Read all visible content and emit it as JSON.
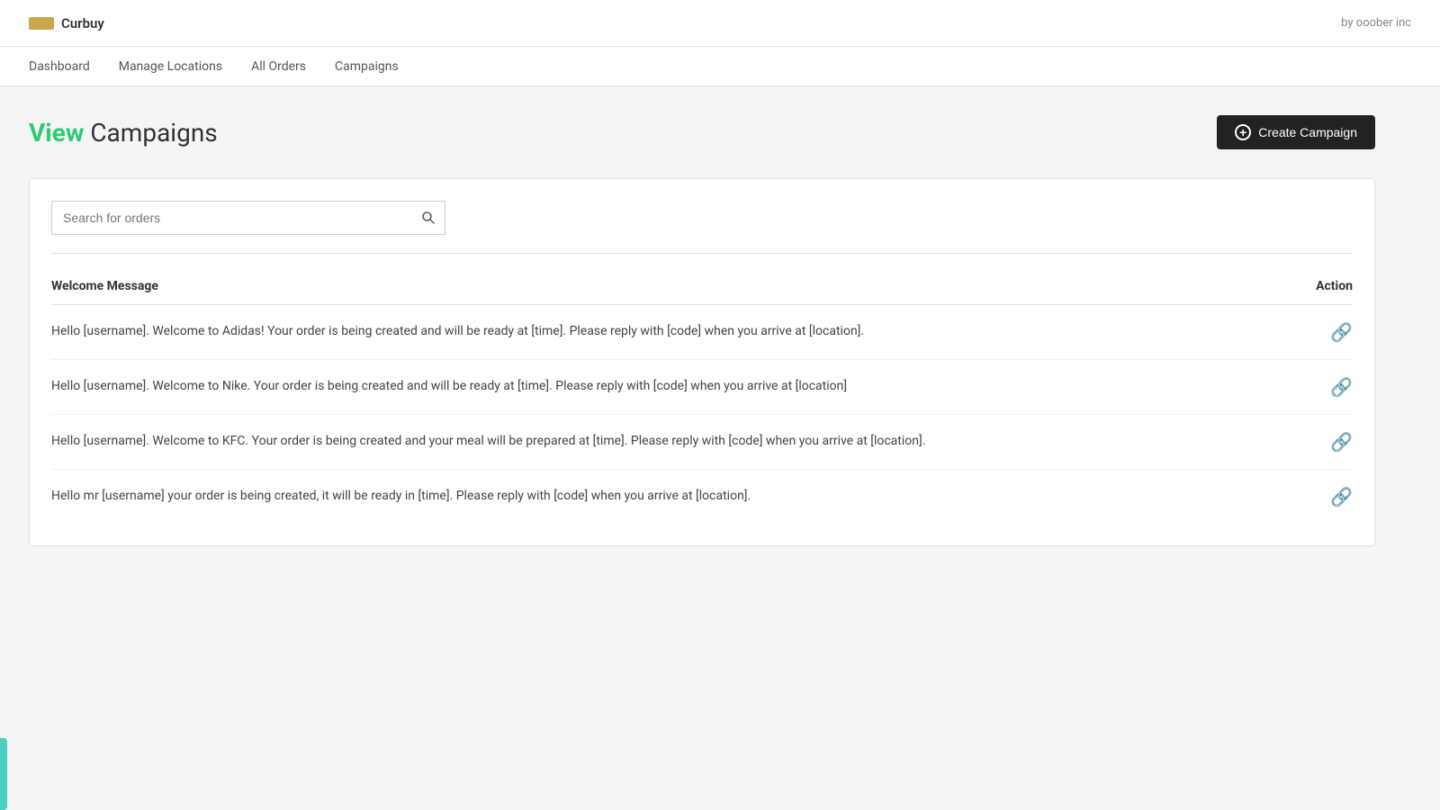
{
  "topbar": {
    "logo_icon_label": "logo-icon",
    "logo_text": "Curbuy",
    "by_text": "by ooober inc"
  },
  "nav": {
    "items": [
      {
        "label": "Dashboard",
        "id": "dashboard"
      },
      {
        "label": "Manage Locations",
        "id": "manage-locations"
      },
      {
        "label": "All Orders",
        "id": "all-orders"
      },
      {
        "label": "Campaigns",
        "id": "campaigns"
      }
    ]
  },
  "page": {
    "title_highlight": "View",
    "title_rest": " Campaigns",
    "create_btn_label": "Create Campaign"
  },
  "search": {
    "placeholder": "Search for orders"
  },
  "table": {
    "col_message": "Welcome Message",
    "col_action": "Action",
    "rows": [
      {
        "message": "Hello [username]. Welcome to Adidas! Your order is being created and will be ready at [time]. Please reply with [code] when you arrive at [location]."
      },
      {
        "message": "Hello [username]. Welcome to Nike. Your order is being created and will be ready at [time]. Please reply with [code] when you arrive at [location]"
      },
      {
        "message": "Hello [username]. Welcome to KFC. Your order is being created and your meal will be prepared at [time]. Please reply with [code] when you arrive at [location]."
      },
      {
        "message": "Hello mr [username] your order is being created, it will be ready in [time]. Please reply with [code] when you arrive at [location]."
      }
    ]
  }
}
